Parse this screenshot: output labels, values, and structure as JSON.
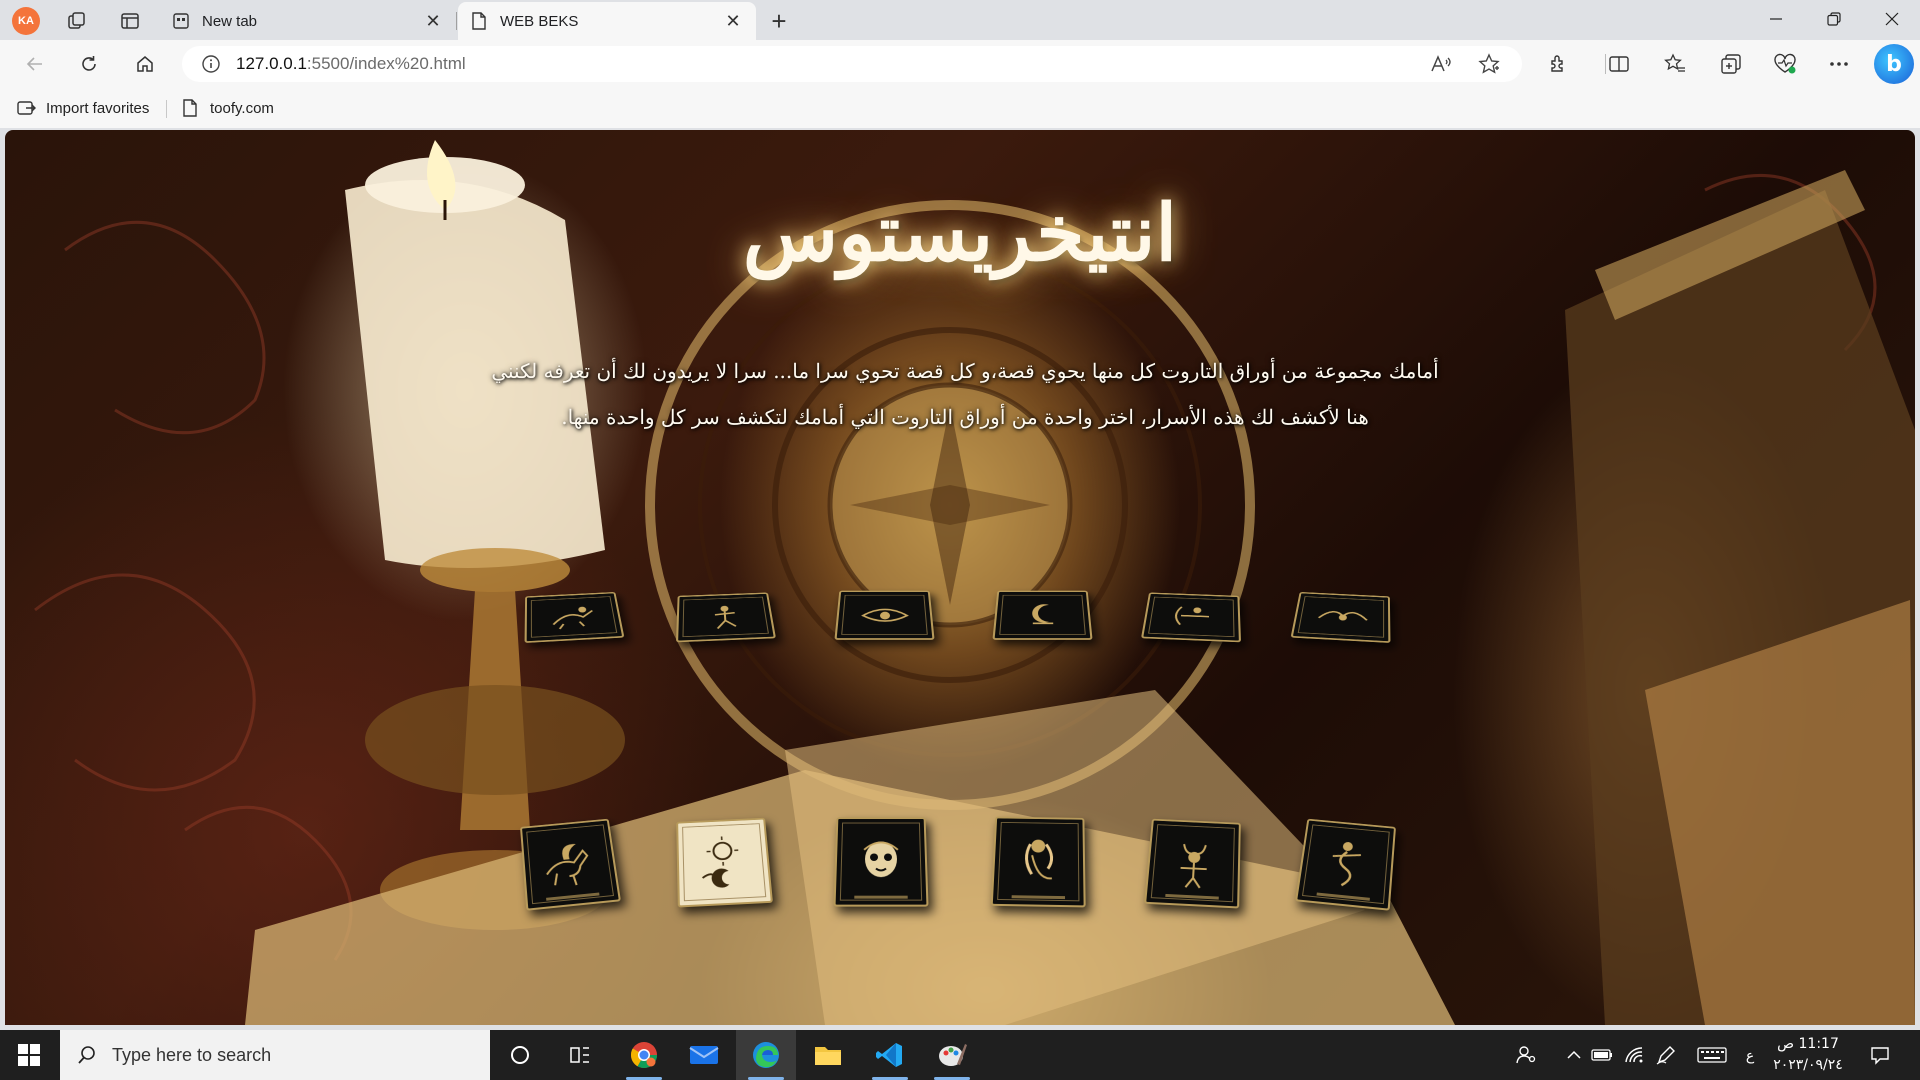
{
  "browser": {
    "profile_initials": "KA",
    "tabs": [
      {
        "title": "New tab",
        "active": false
      },
      {
        "title": "WEB BEKS",
        "active": true
      }
    ],
    "url_host": "127.0.0.1",
    "url_path": ":5500/index%20.html",
    "favorites": [
      {
        "label": "Import favorites"
      },
      {
        "label": "toofy.com"
      }
    ],
    "copilot_letter": "b"
  },
  "page": {
    "title": "انتيخريستوس",
    "intro_line1": "أمامك مجموعة من أوراق التاروت كل منها يحوي قصة،و كل قصة تحوي سرا ما... سرا لا يريدون لك أن تعرفه لكنني",
    "intro_line2": "هنا لأكشف لك هذه الأسرار، اختر واحدة من أوراق التاروت التي أمامك لتكشف سر كل واحدة منها.",
    "cards_top": [
      {
        "icon": "rider-figure-icon"
      },
      {
        "icon": "dancer-figure-icon"
      },
      {
        "icon": "eye-temple-icon"
      },
      {
        "icon": "moon-figure-icon"
      },
      {
        "icon": "archer-figure-icon"
      },
      {
        "icon": "flying-figure-icon"
      }
    ],
    "cards_bottom": [
      {
        "icon": "pegasus-icon"
      },
      {
        "icon": "sun-moon-icon"
      },
      {
        "icon": "skull-mask-icon"
      },
      {
        "icon": "maiden-figure-icon"
      },
      {
        "icon": "horned-figure-icon"
      },
      {
        "icon": "serpent-figure-icon"
      }
    ],
    "colors": {
      "card_bg": "#0d0d0c",
      "card_gold": "#c9a862",
      "title_glow": "#ffdc8c"
    }
  },
  "taskbar": {
    "search_placeholder": "Type here to search",
    "time": "11:17 ص",
    "date": "٢٠٢٣/٠٩/٢٤",
    "input_lang": "ع"
  }
}
